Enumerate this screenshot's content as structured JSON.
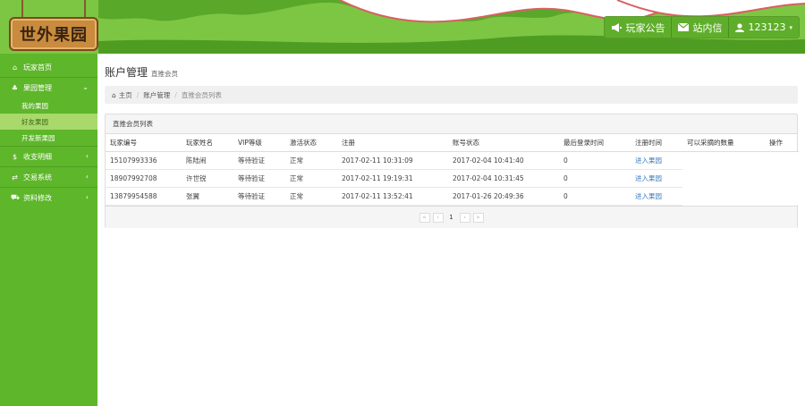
{
  "header": {
    "logo_text": "世外果园",
    "nav": [
      {
        "icon": "megaphone-icon",
        "label": "玩家公告"
      },
      {
        "icon": "envelope-icon",
        "label": "站内信"
      },
      {
        "icon": "user-icon",
        "label": "123123"
      }
    ]
  },
  "sidebar": {
    "items": [
      {
        "icon": "home-icon",
        "label": "玩家首页"
      },
      {
        "icon": "tree-icon",
        "label": "果园管理"
      },
      {
        "sub": "我的果园"
      },
      {
        "sub": "好友果园",
        "active": true
      },
      {
        "sub": "开发新果园"
      },
      {
        "icon": "dollar-icon",
        "label": "收支明细"
      },
      {
        "icon": "exchange-icon",
        "label": "交易系统"
      },
      {
        "icon": "cart-icon",
        "label": "资料修改"
      }
    ]
  },
  "page": {
    "title": "账户管理",
    "subtitle": "直推会员",
    "breadcrumb": [
      "主页",
      "账户管理",
      "直推会员列表"
    ]
  },
  "panel": {
    "title": "直推会员列表",
    "columns": [
      "玩家编号",
      "玩家姓名",
      "VIP等级",
      "激活状态",
      "注册",
      "账号状态",
      "最后登录时间",
      "注册时间",
      "可以采摘的数量",
      "操作"
    ],
    "rows": [
      [
        "15107993336",
        "陈陆闹",
        "等待验证",
        "正常",
        "2017-02-11 10:31:09",
        "2017-02-04 10:41:40",
        "0",
        "进入果园"
      ],
      [
        "18907992708",
        "许世锐",
        "等待验证",
        "正常",
        "2017-02-11 19:19:31",
        "2017-02-04 10:31:45",
        "0",
        "进入果园"
      ],
      [
        "13879954588",
        "张翼",
        "等待验证",
        "正常",
        "2017-02-11 13:52:41",
        "2017-01-26 20:49:36",
        "0",
        "进入果园"
      ]
    ],
    "pagination": [
      "«",
      "‹",
      "1",
      "›",
      "»"
    ]
  },
  "colors": {
    "header_green": "#7cc644",
    "sidebar_green": "#5eb62a",
    "active_sub": "#a9d96b",
    "link": "#3a7cc0"
  }
}
